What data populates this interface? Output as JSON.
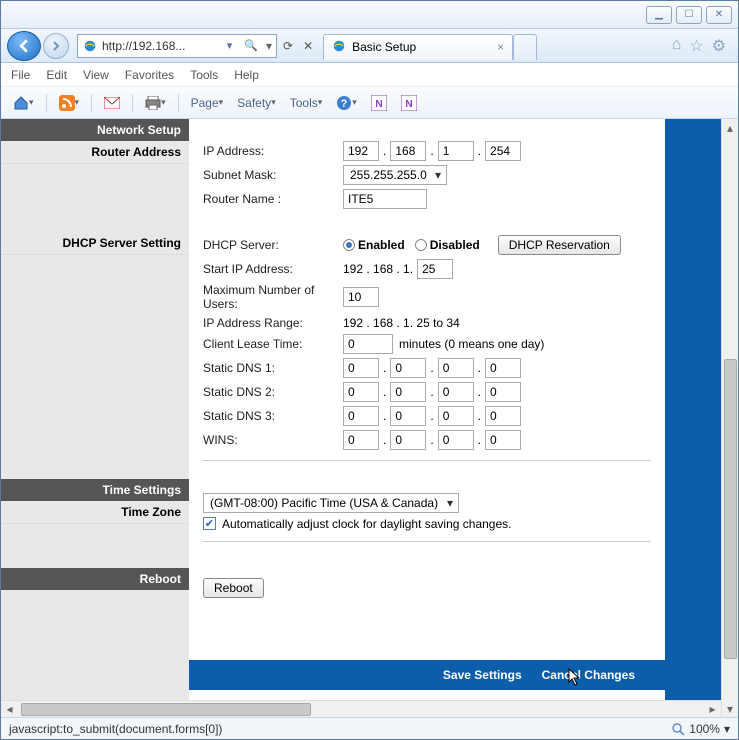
{
  "window": {
    "min": "▁",
    "max": "☐",
    "close": "✕"
  },
  "nav": {
    "url": "http://192.168...",
    "search_hint": "🔎",
    "refresh": "⟳",
    "stop": "✕",
    "dropdown": "▾"
  },
  "tab": {
    "title": "Basic Setup",
    "close": "×"
  },
  "chrome_icons": {
    "home": "⌂",
    "star": "☆",
    "gear": "⚙"
  },
  "menubar": {
    "file": "File",
    "edit": "Edit",
    "view": "View",
    "favorites": "Favorites",
    "tools": "Tools",
    "help": "Help"
  },
  "toolbar": {
    "page": "Page",
    "safety": "Safety",
    "tools": "Tools"
  },
  "sections": {
    "network_setup": "Network Setup",
    "router_address": "Router Address",
    "dhcp_setting": "DHCP Server Setting",
    "time_settings": "Time Settings",
    "time_zone": "Time Zone",
    "reboot": "Reboot"
  },
  "labels": {
    "ip_address": "IP Address:",
    "subnet_mask": "Subnet Mask:",
    "router_name": "Router Name :",
    "dhcp_server": "DHCP Server:",
    "start_ip": "Start IP Address:",
    "max_users": "Maximum Number of Users:",
    "ip_range": "IP Address Range:",
    "lease_time": "Client Lease Time:",
    "lease_suffix": "minutes (0 means one day)",
    "dns1": "Static DNS 1:",
    "dns2": "Static DNS 2:",
    "dns3": "Static DNS 3:",
    "wins": "WINS:",
    "daylight": "Automatically adjust clock for daylight saving changes."
  },
  "values": {
    "ip": {
      "a": "192",
      "b": "168",
      "c": "1",
      "d": "254"
    },
    "subnet": "255.255.255.0",
    "router_name": "ITE5",
    "enabled": "Enabled",
    "disabled": "Disabled",
    "dhcp_res_btn": "DHCP Reservation",
    "start_prefix": "192 . 168 . 1.",
    "start_last": "25",
    "max_users": "10",
    "ip_range": "192 . 168 . 1. 25 to 34",
    "lease": "0",
    "dns1": {
      "a": "0",
      "b": "0",
      "c": "0",
      "d": "0"
    },
    "dns2": {
      "a": "0",
      "b": "0",
      "c": "0",
      "d": "0"
    },
    "dns3": {
      "a": "0",
      "b": "0",
      "c": "0",
      "d": "0"
    },
    "wins": {
      "a": "0",
      "b": "0",
      "c": "0",
      "d": "0"
    },
    "timezone": "(GMT-08:00) Pacific Time (USA & Canada)",
    "reboot_btn": "Reboot",
    "save": "Save Settings",
    "cancel": "Cancel Changes"
  },
  "status": {
    "text": "javascript:to_submit(document.forms[0])",
    "zoom": "100%"
  }
}
